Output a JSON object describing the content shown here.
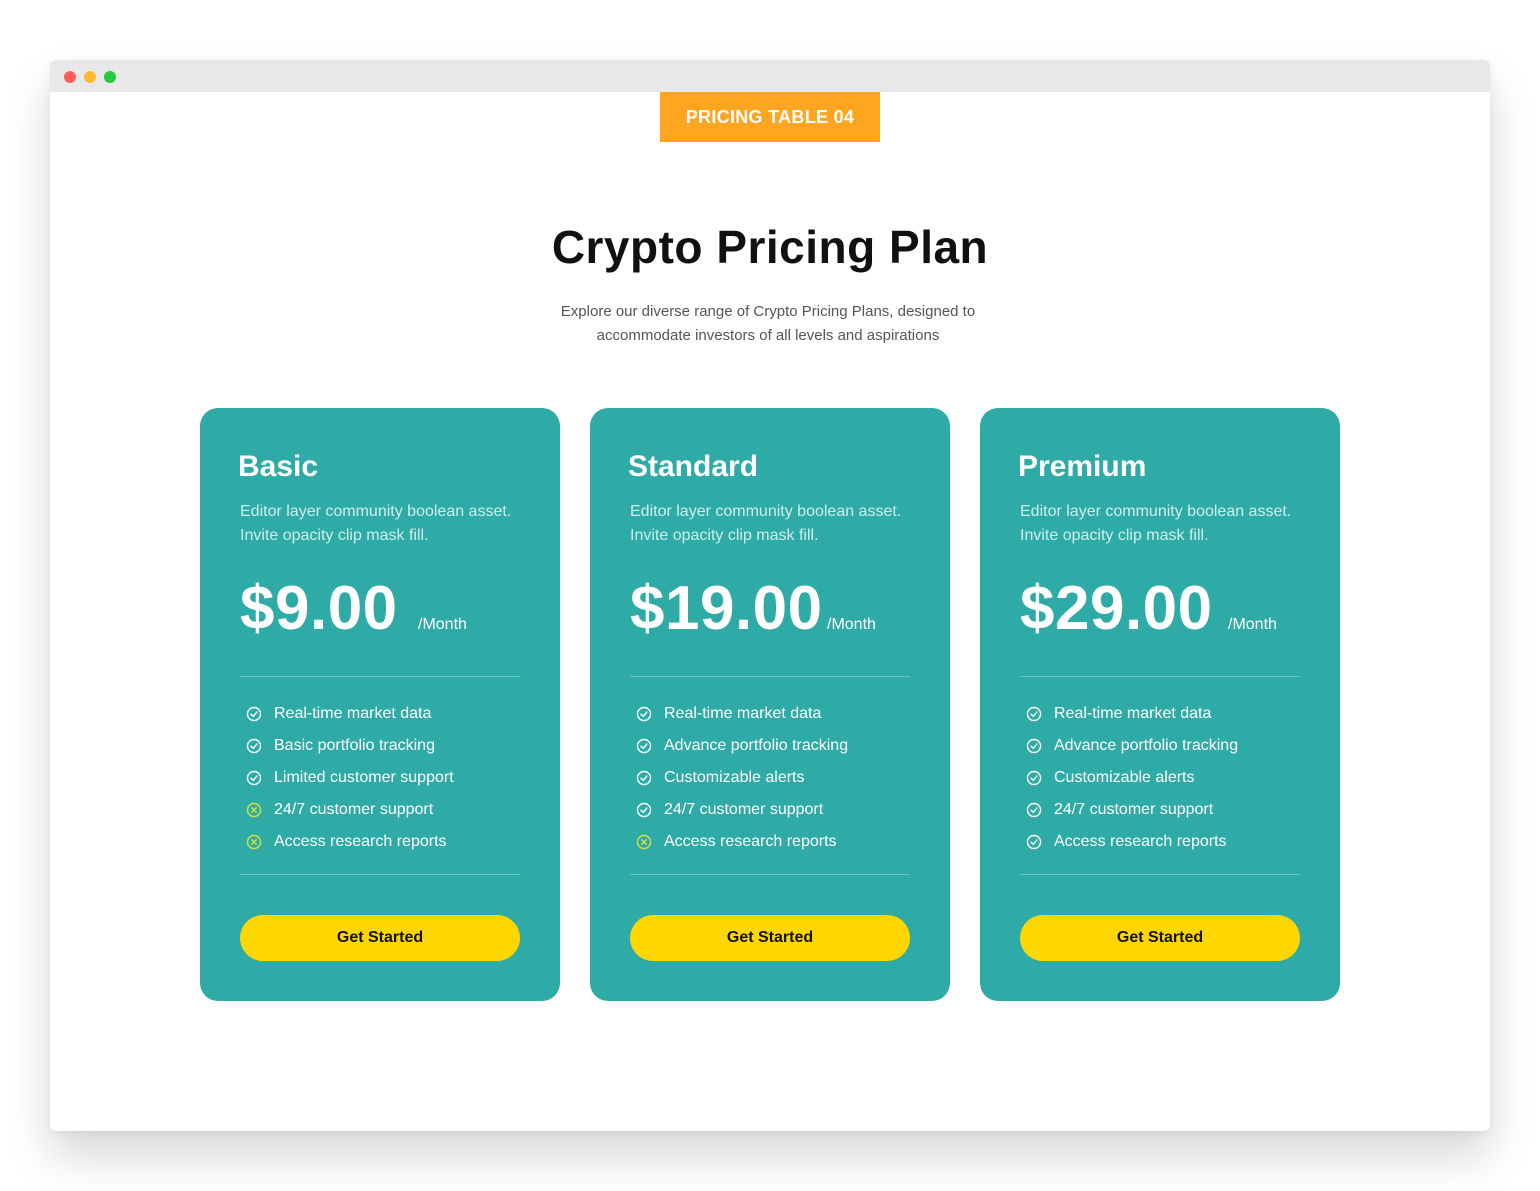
{
  "colors": {
    "tag_background": "#ffa51f",
    "card_background": "#2eaba6",
    "button_background": "#ffd600",
    "included_icon": "#ffffff",
    "excluded_icon": "#d4e23a"
  },
  "tag": "PRICING TABLE 04",
  "header": {
    "title": "Crypto Pricing Plan",
    "subtitle": "Explore our diverse range of Crypto Pricing Plans, designed to accommodate investors of all levels and aspirations"
  },
  "plans": [
    {
      "name": "Basic",
      "description": "Editor layer community boolean asset. Invite opacity clip mask fill.",
      "price": "$9.00",
      "period": "/Month",
      "features": [
        {
          "label": "Real-time market data",
          "icon": "check-circle-icon",
          "included": true
        },
        {
          "label": "Basic portfolio tracking",
          "icon": "check-circle-icon",
          "included": true
        },
        {
          "label": "Limited customer support",
          "icon": "check-circle-icon",
          "included": true
        },
        {
          "label": "24/7 customer support",
          "icon": "x-circle-icon",
          "included": false
        },
        {
          "label": "Access research reports",
          "icon": "x-circle-icon",
          "included": false
        }
      ],
      "button": "Get Started"
    },
    {
      "name": "Standard",
      "description": "Editor layer community boolean asset. Invite opacity clip mask fill.",
      "price": "$19.00",
      "period": "/Month",
      "features": [
        {
          "label": "Real-time market data",
          "icon": "check-circle-icon",
          "included": true
        },
        {
          "label": "Advance portfolio tracking",
          "icon": "check-circle-icon",
          "included": true
        },
        {
          "label": "Customizable alerts",
          "icon": "check-circle-icon",
          "included": true
        },
        {
          "label": "24/7 customer support",
          "icon": "check-circle-icon",
          "included": true
        },
        {
          "label": "Access research reports",
          "icon": "x-circle-icon",
          "included": false
        }
      ],
      "button": "Get Started"
    },
    {
      "name": "Premium",
      "description": "Editor layer community boolean asset. Invite opacity clip mask fill.",
      "price": "$29.00",
      "period": "/Month",
      "features": [
        {
          "label": "Real-time market data",
          "icon": "check-circle-icon",
          "included": true
        },
        {
          "label": "Advance portfolio tracking",
          "icon": "check-circle-icon",
          "included": true
        },
        {
          "label": "Customizable alerts",
          "icon": "check-circle-icon",
          "included": true
        },
        {
          "label": "24/7 customer support",
          "icon": "check-circle-icon",
          "included": true
        },
        {
          "label": "Access research reports",
          "icon": "check-circle-icon",
          "included": true
        }
      ],
      "button": "Get Started"
    }
  ]
}
